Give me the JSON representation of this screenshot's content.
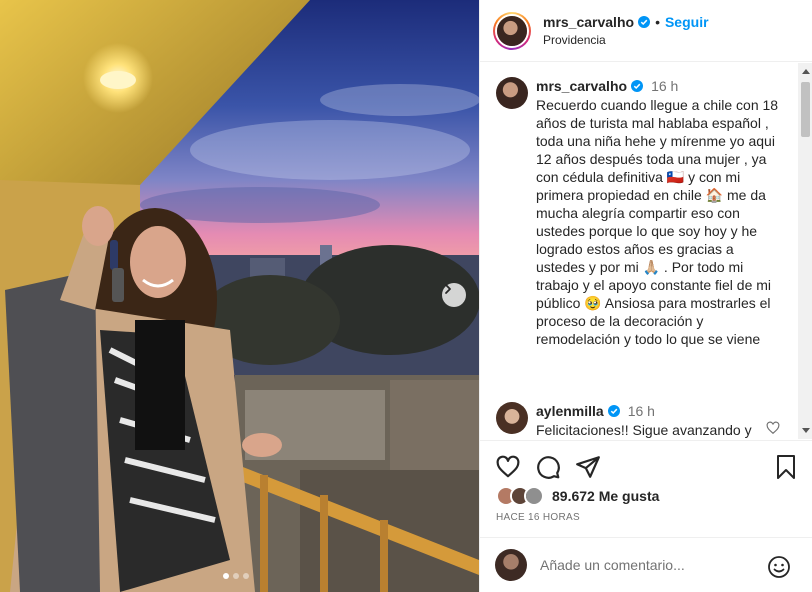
{
  "post": {
    "username": "mrs_carvalho",
    "location": "Providencia",
    "follow_label": "Seguir",
    "separator": "•",
    "slide_count": 3,
    "active_slide": 1
  },
  "caption": {
    "username": "mrs_carvalho",
    "time": "16 h",
    "text": "Recuerdo cuando llegue a chile con 18 años de turista mal hablaba español , toda una niña hehe y mírenme yo aqui 12 años después toda una mujer , ya con cédula definitiva 🇨🇱 y con mi primera propiedad en chile 🏠 me da mucha alegría compartir eso con ustedes porque lo que soy hoy y he logrado estos años es gracias a ustedes y por mi 🙏🏼 . Por todo mi trabajo y el apoyo constante fiel de mi público 🥹 Ansiosa para mostrarles el proceso de la decoración y remodelación y todo lo que se viene"
  },
  "comments": [
    {
      "username": "aylenmilla",
      "time": "16 h",
      "text": "Felicitaciones!! Sigue avanzando y prosperando 🙏🏼✨❤️"
    }
  ],
  "likes": {
    "count_text": "89.672 Me gusta"
  },
  "date_text": "HACE 16 HORAS",
  "add_comment": {
    "placeholder": "Añade un comentario..."
  },
  "icons": {
    "like": "heart-icon",
    "comment": "comment-bubble-icon",
    "share": "send-paper-plane-icon",
    "save": "bookmark-icon",
    "emoji": "smiley-icon",
    "verified": "verified-badge-icon",
    "next": "chevron-right-icon"
  },
  "colors": {
    "accent": "#0095f6",
    "muted": "#737373",
    "text": "#262626"
  }
}
